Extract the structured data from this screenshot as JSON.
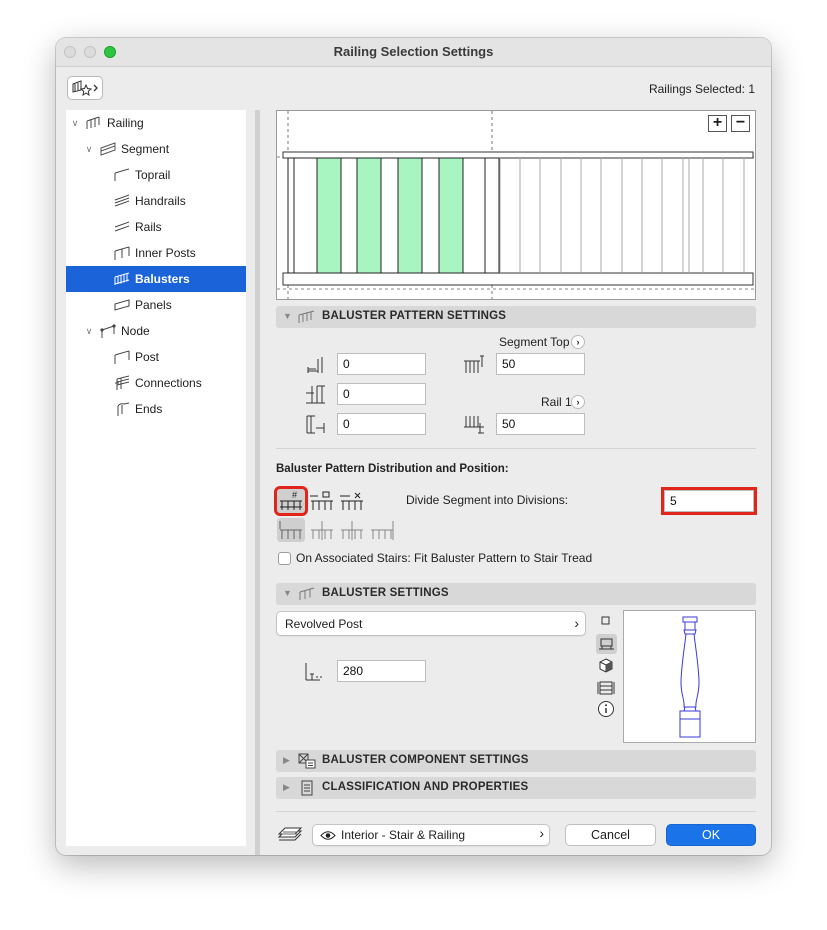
{
  "window": {
    "title": "Railing Selection Settings",
    "selection_count": "Railings Selected: 1"
  },
  "tree": [
    {
      "label": "Railing",
      "level": 0,
      "expanded": true,
      "icon": "railing-icon",
      "selected": false
    },
    {
      "label": "Segment",
      "level": 1,
      "expanded": true,
      "icon": "segment-icon",
      "selected": false
    },
    {
      "label": "Toprail",
      "level": 2,
      "icon": "toprail-icon",
      "selected": false
    },
    {
      "label": "Handrails",
      "level": 2,
      "icon": "handrails-icon",
      "selected": false
    },
    {
      "label": "Rails",
      "level": 2,
      "icon": "rails-icon",
      "selected": false
    },
    {
      "label": "Inner Posts",
      "level": 2,
      "icon": "inner-posts-icon",
      "selected": false
    },
    {
      "label": "Balusters",
      "level": 2,
      "icon": "balusters-icon",
      "selected": true
    },
    {
      "label": "Panels",
      "level": 2,
      "icon": "panels-icon",
      "selected": false
    },
    {
      "label": "Node",
      "level": 1,
      "expanded": true,
      "icon": "node-icon",
      "selected": false
    },
    {
      "label": "Post",
      "level": 2,
      "icon": "post-icon",
      "selected": false
    },
    {
      "label": "Connections",
      "level": 2,
      "icon": "connections-icon",
      "selected": false
    },
    {
      "label": "Ends",
      "level": 2,
      "icon": "ends-icon",
      "selected": false
    }
  ],
  "preview": {
    "zoom_in": "+",
    "zoom_out": "−",
    "accent": "#a8f5c2"
  },
  "pattern_settings": {
    "title": "BALUSTER PATTERN SETTINGS",
    "left_offset": "0",
    "pattern_length": "0",
    "right_offset": "0",
    "segment_top_label": "Segment Top",
    "segment_top_value": "50",
    "rail_label": "Rail 1",
    "rail_value": "50"
  },
  "distribution": {
    "heading": "Baluster Pattern Distribution and Position:",
    "divide_label": "Divide Segment into Divisions:",
    "divide_value": "5",
    "stairs_checkbox_label": "On Associated Stairs: Fit Baluster Pattern to Stair Tread",
    "stairs_checked": false,
    "highlight_color": "#e0251b"
  },
  "baluster_settings": {
    "title": "BALUSTER SETTINGS",
    "profile": "Revolved Post",
    "height": "280"
  },
  "collapsed_sections": {
    "component": "BALUSTER COMPONENT SETTINGS",
    "classification": "CLASSIFICATION AND PROPERTIES"
  },
  "footer": {
    "view": "Interior - Stair & Railing",
    "cancel": "Cancel",
    "ok": "OK",
    "ok_color": "#1a73e8"
  }
}
